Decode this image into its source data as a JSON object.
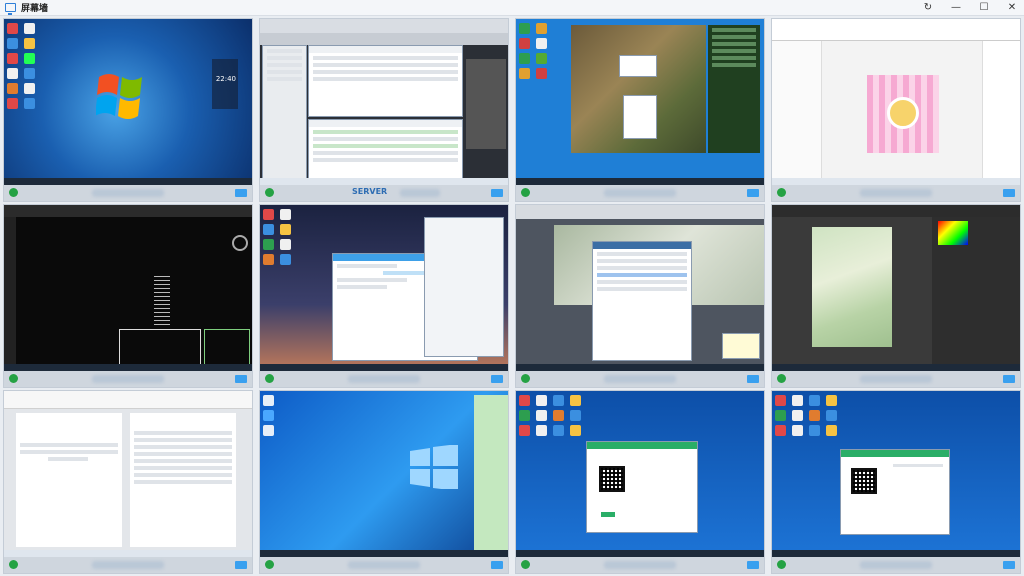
{
  "window": {
    "title": "屏幕墙"
  },
  "controls": {
    "refresh_glyph": "↻",
    "minimize_glyph": "—",
    "maximize_glyph": "☐",
    "close_glyph": "✕"
  },
  "tiles": [
    {
      "label": "",
      "screen": "win7-desktop",
      "clock": "22:40"
    },
    {
      "label": "SERVER",
      "screen": "server-manager"
    },
    {
      "label": "",
      "screen": "game-window"
    },
    {
      "label": "",
      "screen": "image-editor"
    },
    {
      "label": "",
      "screen": "cad"
    },
    {
      "label": "",
      "screen": "chat"
    },
    {
      "label": "",
      "screen": "gis-dialogs"
    },
    {
      "label": "",
      "screen": "photoshop-map"
    },
    {
      "label": "",
      "screen": "word-document"
    },
    {
      "label": "",
      "screen": "win10-desktop"
    },
    {
      "label": "",
      "screen": "qr-login"
    },
    {
      "label": "",
      "screen": "qr-login-2"
    }
  ],
  "colors": {
    "online": "#25a244",
    "accent": "#2e6db3"
  }
}
